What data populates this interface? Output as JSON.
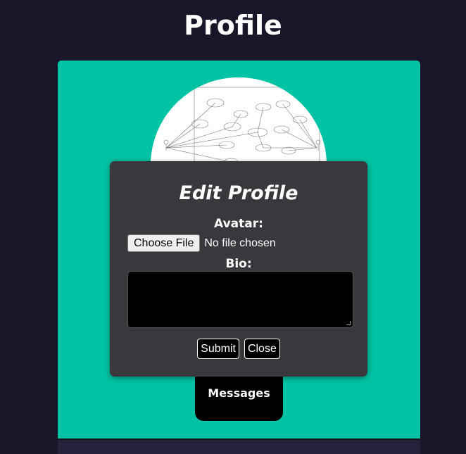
{
  "header": {
    "title": "Profile"
  },
  "profile": {
    "avatar_image": "diagram-thumbnail",
    "messages_label": "Messages"
  },
  "modal": {
    "title": "Edit Profile",
    "avatar_label": "Avatar:",
    "choose_file_label": "Choose File",
    "file_status": "No file chosen",
    "bio_label": "Bio:",
    "bio_value": "",
    "submit_label": "Submit",
    "close_label": "Close"
  },
  "colors": {
    "page_background": "#1a1528",
    "card_background": "#00c2a4",
    "modal_background": "#3a373d",
    "button_background": "#000000"
  }
}
